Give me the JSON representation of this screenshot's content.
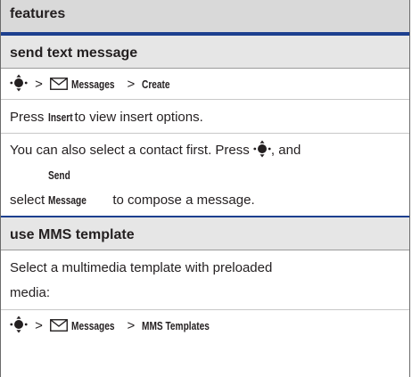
{
  "header": {
    "title": "features"
  },
  "sections": [
    {
      "title": "send text message",
      "path": {
        "sep": ">",
        "item1": "Messages",
        "item2": "Create"
      },
      "line1_pre": "Press",
      "line1_key": "Insert",
      "line1_post": "to view insert options.",
      "line2a_pre": "You can also select a contact first. Press",
      "line2a_post": ", and",
      "line2b_pre": "select",
      "line2b_key": "Send Message",
      "line2b_post": "to compose a message."
    },
    {
      "title": "use MMS template",
      "desc_line1": "Select a multimedia template with preloaded",
      "desc_line2": "media:",
      "path": {
        "sep": ">",
        "item1": "Messages",
        "item2": "MMS Templates"
      }
    }
  ],
  "colors": {
    "accent_blue": "#1c3f8f",
    "header_gray": "#d9d9d9",
    "title_gray": "#e6e6e6"
  },
  "icons": [
    "nav-key-icon",
    "envelope-icon"
  ]
}
